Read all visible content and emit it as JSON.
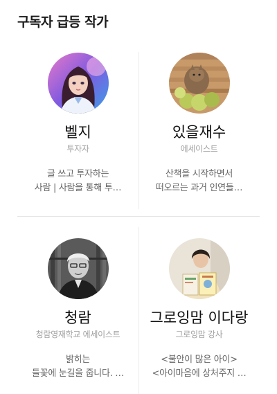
{
  "section": {
    "title": "구독자 급등 작가"
  },
  "writers": [
    {
      "name": "벨지",
      "job": "투자자",
      "desc_line1": "글 쓰고 투자하는",
      "desc_line2": "사람 | 사람을 통해 투…"
    },
    {
      "name": "있을재수",
      "job": "에세이스트",
      "desc_line1": "산책을 시작하면서",
      "desc_line2": "떠오르는 과거 인연들…"
    },
    {
      "name": "청람",
      "job": "청람영재학교 에세이스트",
      "desc_line1": "밝히는",
      "desc_line2": "들꽃에 눈길을 줍니다. …"
    },
    {
      "name": "그로잉맘 이다랑",
      "job": "그로잉맘 강사",
      "desc_line1": "<불안이 많은 아이>",
      "desc_line2": "<아이마음에 상처주지 …"
    }
  ]
}
